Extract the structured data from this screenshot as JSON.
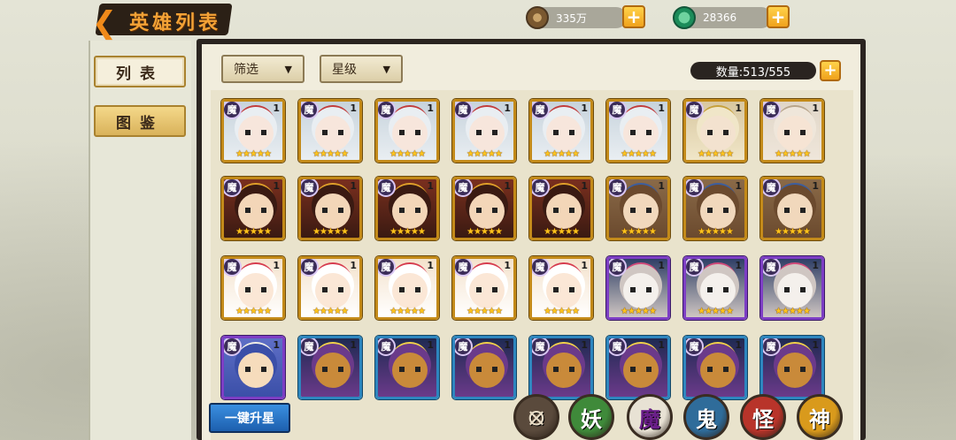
{
  "header": {
    "title": "英雄列表",
    "coins": "335万",
    "jade": "28366"
  },
  "tabs": [
    {
      "label": "列表",
      "active": true
    },
    {
      "label": "图鉴",
      "active": false
    }
  ],
  "filters": {
    "filter_label": "筛选",
    "star_label": "星级"
  },
  "count_text": "数量:513/555",
  "upgrade_label": "一键升星",
  "factions": [
    {
      "label": "",
      "name": "all",
      "color": "#5a4a3c"
    },
    {
      "label": "妖",
      "name": "yao",
      "color": "#3f8a3a"
    },
    {
      "label": "魔",
      "name": "mo",
      "color": "#e8e2d4"
    },
    {
      "label": "鬼",
      "name": "gui",
      "color": "#2f6c9a"
    },
    {
      "label": "怪",
      "name": "guai",
      "color": "#b8342a"
    },
    {
      "label": "神",
      "name": "shen",
      "color": "#d99a1c"
    }
  ],
  "heroes": [
    [
      {
        "badge": "魔",
        "level": "1",
        "stars": "★★★★★",
        "frame": "gold",
        "art": "white-crown"
      },
      {
        "badge": "魔",
        "level": "1",
        "stars": "★★★★★",
        "frame": "gold",
        "art": "white-crown"
      },
      {
        "badge": "魔",
        "level": "1",
        "stars": "★★★★★",
        "frame": "gold",
        "art": "white-crown"
      },
      {
        "badge": "魔",
        "level": "1",
        "stars": "★★★★★",
        "frame": "gold",
        "art": "white-crown"
      },
      {
        "badge": "魔",
        "level": "1",
        "stars": "★★★★★",
        "frame": "gold",
        "art": "white-crown"
      },
      {
        "badge": "魔",
        "level": "1",
        "stars": "★★★★★",
        "frame": "gold",
        "art": "white-crown"
      },
      {
        "badge": "魔",
        "level": "1",
        "stars": "★★★★★",
        "frame": "gold",
        "art": "gold-helm"
      },
      {
        "badge": "魔",
        "level": "1",
        "stars": "★★★★★",
        "frame": "gold",
        "art": "pale-elder"
      }
    ],
    [
      {
        "badge": "魔",
        "level": "1",
        "stars": "★★★★★",
        "frame": "gold",
        "art": "red-king"
      },
      {
        "badge": "魔",
        "level": "1",
        "stars": "★★★★★",
        "frame": "gold",
        "art": "red-king"
      },
      {
        "badge": "魔",
        "level": "1",
        "stars": "★★★★★",
        "frame": "gold",
        "art": "red-king"
      },
      {
        "badge": "魔",
        "level": "1",
        "stars": "★★★★★",
        "frame": "gold",
        "art": "red-king"
      },
      {
        "badge": "魔",
        "level": "1",
        "stars": "★★★★★",
        "frame": "gold",
        "art": "red-king"
      },
      {
        "badge": "魔",
        "level": "1",
        "stars": "★★★★★",
        "frame": "gold",
        "art": "brown-swordsman"
      },
      {
        "badge": "魔",
        "level": "1",
        "stars": "★★★★★",
        "frame": "gold",
        "art": "brown-swordsman"
      },
      {
        "badge": "魔",
        "level": "1",
        "stars": "★★★★★",
        "frame": "gold",
        "art": "brown-swordsman"
      }
    ],
    [
      {
        "badge": "魔",
        "level": "1",
        "stars": "★★★★★",
        "frame": "gold",
        "art": "headband-girl"
      },
      {
        "badge": "魔",
        "level": "1",
        "stars": "★★★★★",
        "frame": "gold",
        "art": "headband-girl"
      },
      {
        "badge": "魔",
        "level": "1",
        "stars": "★★★★★",
        "frame": "gold",
        "art": "headband-girl"
      },
      {
        "badge": "魔",
        "level": "1",
        "stars": "★★★★★",
        "frame": "gold",
        "art": "headband-girl"
      },
      {
        "badge": "魔",
        "level": "1",
        "stars": "★★★★★",
        "frame": "gold",
        "art": "headband-girl"
      },
      {
        "badge": "魔",
        "level": "1",
        "stars": "★★★★★",
        "frame": "purple",
        "art": "fox-mask"
      },
      {
        "badge": "魔",
        "level": "1",
        "stars": "★★★★★",
        "frame": "purple",
        "art": "fox-mask"
      },
      {
        "badge": "魔",
        "level": "1",
        "stars": "★★★★★",
        "frame": "purple",
        "art": "fox-mask"
      }
    ],
    [
      {
        "badge": "魔",
        "level": "1",
        "stars": "",
        "frame": "purple",
        "art": "blue-hat"
      },
      {
        "badge": "魔",
        "level": "1",
        "stars": "",
        "frame": "blue",
        "art": "ox-demon"
      },
      {
        "badge": "魔",
        "level": "1",
        "stars": "",
        "frame": "blue",
        "art": "ox-demon"
      },
      {
        "badge": "魔",
        "level": "1",
        "stars": "",
        "frame": "blue",
        "art": "ox-demon"
      },
      {
        "badge": "魔",
        "level": "1",
        "stars": "",
        "frame": "blue",
        "art": "ox-demon"
      },
      {
        "badge": "魔",
        "level": "1",
        "stars": "",
        "frame": "blue",
        "art": "ox-demon"
      },
      {
        "badge": "魔",
        "level": "1",
        "stars": "",
        "frame": "blue",
        "art": "ox-demon"
      },
      {
        "badge": "魔",
        "level": "1",
        "stars": "",
        "frame": "blue",
        "art": "ox-demon"
      }
    ]
  ]
}
